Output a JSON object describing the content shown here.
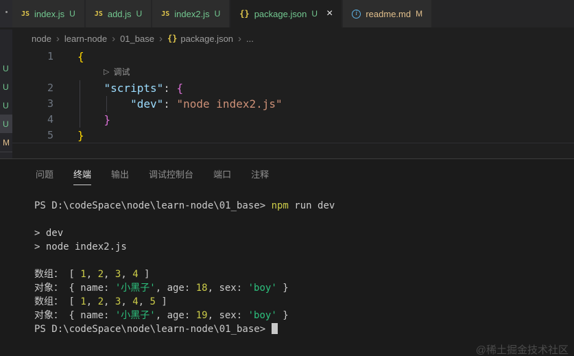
{
  "tabs": [
    {
      "key": "index-js",
      "icon": "js",
      "label": "index.js",
      "badge": "U",
      "state": "untracked",
      "active": false
    },
    {
      "key": "add-js",
      "icon": "js",
      "label": "add.js",
      "badge": "U",
      "state": "untracked",
      "active": false
    },
    {
      "key": "index2-js",
      "icon": "js",
      "label": "index2.js",
      "badge": "U",
      "state": "untracked",
      "active": false
    },
    {
      "key": "package-json",
      "icon": "braces",
      "label": "package.json",
      "badge": "U",
      "state": "untracked",
      "active": true
    },
    {
      "key": "readme-md",
      "icon": "info",
      "label": "readme.md",
      "badge": "M",
      "state": "modified",
      "active": false
    }
  ],
  "breadcrumb": {
    "items": [
      {
        "label": "node"
      },
      {
        "label": "learn-node"
      },
      {
        "label": "01_base"
      },
      {
        "label": "package.json",
        "icon": "braces"
      },
      {
        "label": "..."
      }
    ]
  },
  "editor": {
    "codelens_label": "调试"
  },
  "code_lines": [
    {
      "num": "1",
      "indent": 0,
      "guides": [],
      "tokens": [
        [
          "{",
          "b1"
        ]
      ]
    },
    {
      "lens": true
    },
    {
      "num": "2",
      "indent": 4,
      "guides": [
        0
      ],
      "tokens": [
        [
          "\"scripts\"",
          "key"
        ],
        [
          ": ",
          "fg"
        ],
        [
          "{",
          "b2"
        ]
      ]
    },
    {
      "num": "3",
      "indent": 8,
      "guides": [
        0,
        4
      ],
      "tokens": [
        [
          "\"dev\"",
          "key"
        ],
        [
          ": ",
          "fg"
        ],
        [
          "\"node index2.js\"",
          "str"
        ]
      ]
    },
    {
      "num": "4",
      "indent": 4,
      "guides": [
        0
      ],
      "tokens": [
        [
          "}",
          "b2"
        ]
      ]
    },
    {
      "num": "5",
      "indent": 0,
      "guides": [],
      "tokens": [
        [
          "}",
          "b1"
        ]
      ],
      "current": true
    }
  ],
  "explorer_badges": [
    {
      "label": "U",
      "state": "untracked",
      "selected": false
    },
    {
      "label": "U",
      "state": "untracked",
      "selected": false
    },
    {
      "label": "U",
      "state": "untracked",
      "selected": false
    },
    {
      "label": "U",
      "state": "untracked",
      "selected": true
    },
    {
      "label": "M",
      "state": "modified",
      "selected": false
    }
  ],
  "panel_tabs": [
    {
      "key": "problems",
      "label": "问题",
      "active": false
    },
    {
      "key": "terminal",
      "label": "终端",
      "active": true
    },
    {
      "key": "output",
      "label": "输出",
      "active": false
    },
    {
      "key": "debug-console",
      "label": "调试控制台",
      "active": false
    },
    {
      "key": "ports",
      "label": "端口",
      "active": false
    },
    {
      "key": "comments",
      "label": "注释",
      "active": false
    }
  ],
  "term_lines": [
    [
      [
        "PS D:\\codeSpace\\node\\learn-node\\01_base> ",
        "fg"
      ],
      [
        "npm",
        "y"
      ],
      [
        " run dev",
        "fg"
      ]
    ],
    [],
    [
      [
        "> dev",
        "fg"
      ]
    ],
    [
      [
        "> node index2.js",
        "fg"
      ]
    ],
    [],
    [
      [
        "数组： [ ",
        "fg"
      ],
      [
        "1",
        "y"
      ],
      [
        ", ",
        "fg"
      ],
      [
        "2",
        "y"
      ],
      [
        ", ",
        "fg"
      ],
      [
        "3",
        "y"
      ],
      [
        ", ",
        "fg"
      ],
      [
        "4",
        "y"
      ],
      [
        " ]",
        "fg"
      ]
    ],
    [
      [
        "对象： { name: ",
        "fg"
      ],
      [
        "'小黑子'",
        "g"
      ],
      [
        ", age: ",
        "fg"
      ],
      [
        "18",
        "y"
      ],
      [
        ", sex: ",
        "fg"
      ],
      [
        "'boy'",
        "g"
      ],
      [
        " }",
        "fg"
      ]
    ],
    [
      [
        "数组： [ ",
        "fg"
      ],
      [
        "1",
        "y"
      ],
      [
        ", ",
        "fg"
      ],
      [
        "2",
        "y"
      ],
      [
        ", ",
        "fg"
      ],
      [
        "3",
        "y"
      ],
      [
        ", ",
        "fg"
      ],
      [
        "4",
        "y"
      ],
      [
        ", ",
        "fg"
      ],
      [
        "5",
        "y"
      ],
      [
        " ]",
        "fg"
      ]
    ],
    [
      [
        "对象： { name: ",
        "fg"
      ],
      [
        "'小黑子'",
        "g"
      ],
      [
        ", age: ",
        "fg"
      ],
      [
        "19",
        "y"
      ],
      [
        ", sex: ",
        "fg"
      ],
      [
        "'boy'",
        "g"
      ],
      [
        " }",
        "fg"
      ]
    ],
    [
      [
        "PS D:\\codeSpace\\node\\learn-node\\01_base> ",
        "fg"
      ],
      [
        "",
        "cursor"
      ]
    ]
  ],
  "icon_glyphs": {
    "js": "JS",
    "braces": "{}",
    "info": "i",
    "play": "▷",
    "close": "×",
    "chevron": "›"
  },
  "colors": {
    "untracked": "#73c991",
    "modified": "#e2c08d",
    "tokens": {
      "fg": "#cccccc",
      "key": "#9cdcfe",
      "str": "#ce9178",
      "b1": "#ffd700",
      "b2": "#da70d6",
      "y": "#cdcd49",
      "g": "#2dc27e"
    }
  },
  "watermark": "@稀土掘金技术社区"
}
